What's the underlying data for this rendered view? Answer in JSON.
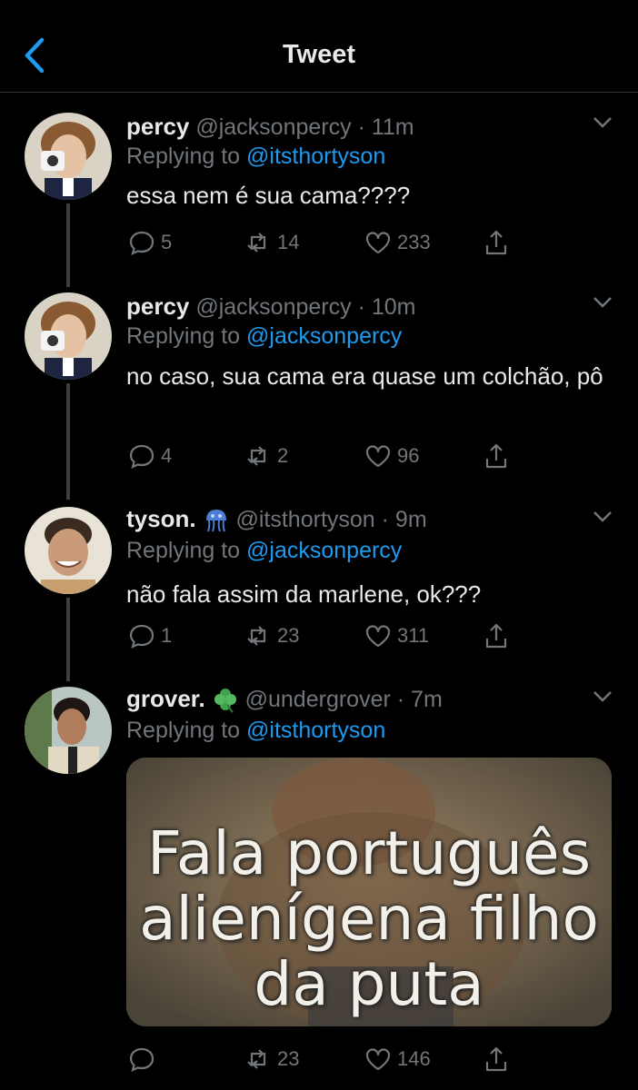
{
  "header": {
    "title": "Tweet"
  },
  "tweets": [
    {
      "name": "percy",
      "handle": "@jacksonpercy",
      "time": "· 11m",
      "replying_prefix": "Replying to ",
      "replying_to": "@itsthortyson",
      "text": "essa nem é sua cama????",
      "replies": "5",
      "retweets": "14",
      "likes": "233"
    },
    {
      "name": "percy",
      "handle": "@jacksonpercy",
      "time": "· 10m",
      "replying_prefix": "Replying to ",
      "replying_to": "@jacksonpercy",
      "text": "no caso, sua cama era quase um colchão, pô",
      "replies": "4",
      "retweets": "2",
      "likes": "96"
    },
    {
      "name": "tyson.",
      "name_emoji": "jellyfish",
      "handle": "@itsthortyson",
      "time": "· 9m",
      "replying_prefix": "Replying to ",
      "replying_to": "@jacksonpercy",
      "text": "não fala assim da marlene, ok???",
      "replies": "1",
      "retweets": "23",
      "likes": "311"
    },
    {
      "name": "grover.",
      "name_emoji": "four-leaf-clover",
      "handle": "@undergrover",
      "time": "· 7m",
      "replying_prefix": "Replying to ",
      "replying_to": "@itsthortyson",
      "media_caption": "Fala português alienígena filho da puta",
      "replies": "",
      "retweets": "23",
      "likes": "146"
    }
  ],
  "colors": {
    "background": "#000000",
    "accent": "#1d9bf0",
    "secondary": "#71767b",
    "text": "#e7e9ea"
  }
}
